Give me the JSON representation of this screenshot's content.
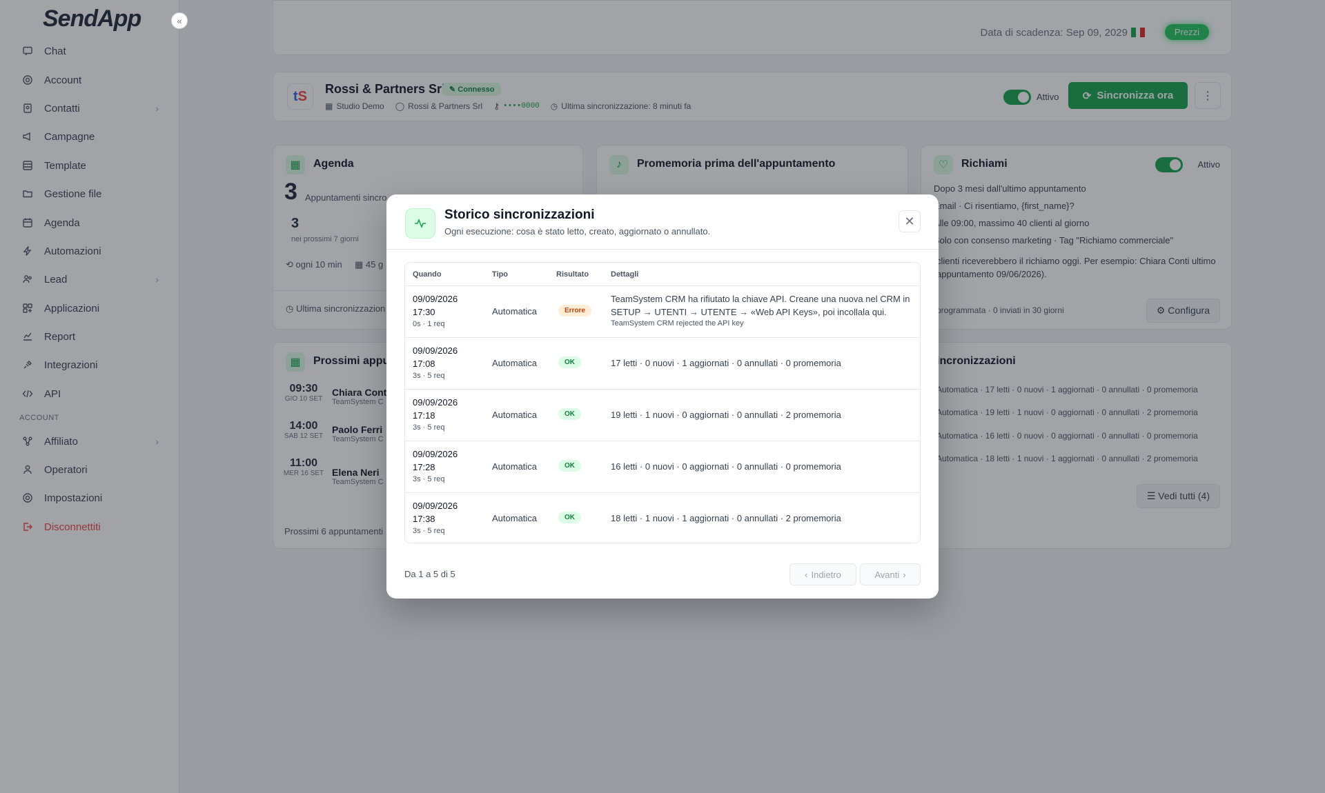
{
  "sidebar": {
    "logo": "SendApp",
    "collapse": "«",
    "items": [
      {
        "label": "Chat",
        "icon": "chat-icon"
      },
      {
        "label": "Account",
        "icon": "gear-icon"
      },
      {
        "label": "Contatti",
        "icon": "contacts-icon"
      },
      {
        "label": "Campagne",
        "icon": "megaphone-icon"
      },
      {
        "label": "Template",
        "icon": "template-icon"
      },
      {
        "label": "Gestione file",
        "icon": "folder-icon"
      },
      {
        "label": "Agenda",
        "icon": "calendar-icon"
      },
      {
        "label": "Automazioni",
        "icon": "lightning-icon"
      },
      {
        "label": "Lead",
        "icon": "users-icon"
      },
      {
        "label": "Applicazioni",
        "icon": "apps-icon"
      },
      {
        "label": "Report",
        "icon": "chart-icon"
      },
      {
        "label": "Integrazioni",
        "icon": "plug-icon"
      },
      {
        "label": "API",
        "icon": "code-icon"
      }
    ],
    "section_account": "ACCOUNT",
    "account_items": [
      {
        "label": "Affiliato",
        "icon": "network-icon"
      },
      {
        "label": "Operatori",
        "icon": "user-icon"
      },
      {
        "label": "Impostazioni",
        "icon": "settings-icon"
      },
      {
        "label": "Disconnettiti",
        "icon": "logout-icon"
      }
    ]
  },
  "topbar": {
    "expiry": "Data di scadenza: Sep 09, 2029",
    "prezzi": "Prezzi"
  },
  "integration": {
    "logo_text": "tS",
    "name": "Rossi & Partners Srl",
    "status": "Connesso",
    "studio": "Studio Demo",
    "account": "Rossi & Partners Srl",
    "key": "••••0000",
    "last_sync": "Ultima sincronizzazione: 8 minuti fa",
    "active_label": "Attivo",
    "sync_button": "Sincronizza ora"
  },
  "agenda": {
    "title": "Agenda",
    "count": "3",
    "count_label": "Appuntamenti sincro",
    "next_count": "3",
    "next_label": "nei prossimi 7 giorni",
    "frequency": "ogni 10 min",
    "range": "45 g",
    "footer": "Ultima sincronizzazion"
  },
  "reminder": {
    "title": "Promemoria prima dell'appuntamento"
  },
  "richiami": {
    "title": "Richiami",
    "active_label": "Attivo",
    "lines": [
      "Dopo 3 mesi dall'ultimo appuntamento",
      "Email · Ci risentiamo, {first_name}?",
      "Alle 09:00, massimo 40 clienti al giorno",
      "Solo con consenso marketing · Tag \"Richiamo commerciale\""
    ],
    "paragraph": "clienti riceverebbero il richiamo oggi. Per esempio: Chiara Conti ultimo appuntamento 09/06/2026).",
    "footer": "programmata · 0 inviati in 30 giorni",
    "configure": "Configura"
  },
  "upcoming": {
    "title": "Prossimi appun",
    "items": [
      {
        "time": "09:30",
        "date": "GIO 10 SET",
        "name": "Chiara Conti",
        "src": "TeamSystem C"
      },
      {
        "time": "14:00",
        "date": "SAB 12 SET",
        "name": "Paolo Ferri",
        "src": "TeamSystem C"
      },
      {
        "time": "11:00",
        "date": "MER 16 SET",
        "name": "Elena Neri",
        "src": "TeamSystem C"
      }
    ],
    "footer": "Prossimi 6 appuntamenti"
  },
  "sync_card": {
    "title": "incronizzazioni",
    "lines": [
      "Automatica · 17 letti · 0 nuovi · 1 aggiornati · 0 annullati · 0 promemoria",
      "Automatica · 19 letti · 1 nuovi · 0 aggiornati · 0 annullati · 2 promemoria",
      "Automatica · 16 letti · 0 nuovi · 0 aggiornati · 0 annullati · 0 promemoria",
      "Automatica · 18 letti · 1 nuovi · 1 aggiornati · 0 annullati · 2 promemoria"
    ],
    "view_all": "Vedi tutti (4)"
  },
  "modal": {
    "title": "Storico sincronizzazioni",
    "subtitle": "Ogni esecuzione: cosa è stato letto, creato, aggiornato o annullato.",
    "columns": {
      "when": "Quando",
      "type": "Tipo",
      "result": "Risultato",
      "details": "Dettagli"
    },
    "rows": [
      {
        "date": "09/09/2026",
        "time": "17:30",
        "meta": "0s · 1 req",
        "type": "Automatica",
        "result": "Errore",
        "details": "TeamSystem CRM ha rifiutato la chiave API. Creane una nuova nel CRM in SETUP → UTENTI → UTENTE → «Web API Keys», poi incollala qui.",
        "sub": "TeamSystem CRM rejected the API key"
      },
      {
        "date": "09/09/2026",
        "time": "17:08",
        "meta": "3s · 5 req",
        "type": "Automatica",
        "result": "OK",
        "details": "17 letti · 0 nuovi · 1 aggiornati · 0 annullati · 0 promemoria"
      },
      {
        "date": "09/09/2026",
        "time": "17:18",
        "meta": "3s · 5 req",
        "type": "Automatica",
        "result": "OK",
        "details": "19 letti · 1 nuovi · 0 aggiornati · 0 annullati · 2 promemoria"
      },
      {
        "date": "09/09/2026",
        "time": "17:28",
        "meta": "3s · 5 req",
        "type": "Automatica",
        "result": "OK",
        "details": "16 letti · 0 nuovi · 0 aggiornati · 0 annullati · 0 promemoria"
      },
      {
        "date": "09/09/2026",
        "time": "17:38",
        "meta": "3s · 5 req",
        "type": "Automatica",
        "result": "OK",
        "details": "18 letti · 1 nuovi · 1 aggiornati · 0 annullati · 2 promemoria"
      }
    ],
    "pagination": "Da 1 a 5 di 5",
    "prev": "Indietro",
    "next": "Avanti"
  },
  "colors": {
    "accent": "#16a34a",
    "danger": "#ef4444",
    "warning": "#c2410c"
  }
}
